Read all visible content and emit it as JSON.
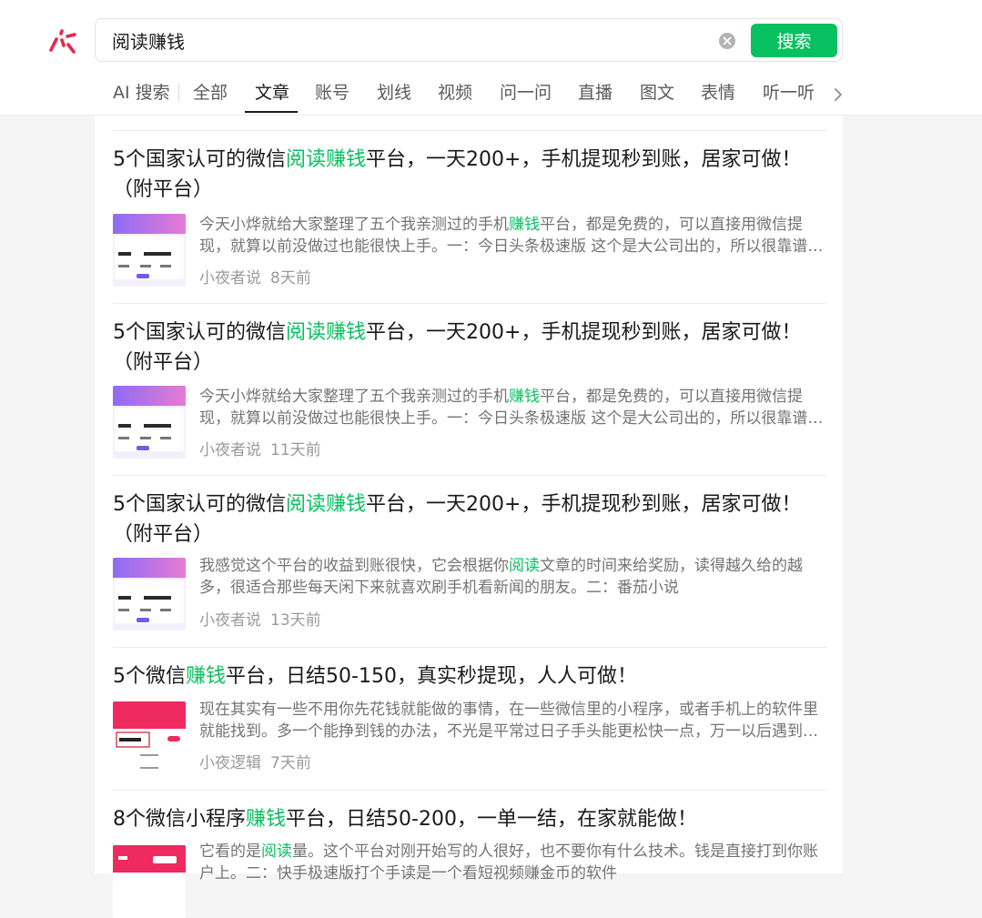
{
  "header": {
    "search": {
      "value": "阅读赚钱",
      "placeholder": "",
      "button_label": "搜索"
    },
    "tabs": [
      {
        "label": "AI 搜索"
      },
      {
        "label": "全部"
      },
      {
        "label": "文章"
      },
      {
        "label": "账号"
      },
      {
        "label": "划线"
      },
      {
        "label": "视频"
      },
      {
        "label": "问一问"
      },
      {
        "label": "直播"
      },
      {
        "label": "图文"
      },
      {
        "label": "表情"
      },
      {
        "label": "听一听"
      }
    ],
    "active_tab": "文章"
  },
  "colors": {
    "accent": "#07c160",
    "logo": "#e8264b"
  },
  "results": [
    {
      "title": [
        {
          "t": "5个国家认可的微信"
        },
        {
          "t": "阅读赚钱",
          "hl": true
        },
        {
          "t": "平台，一天200+，手机提现秒到账，居家可做！（附平台）"
        }
      ],
      "desc": [
        {
          "t": "今天小烨就给大家整理了五个我亲测过的手机"
        },
        {
          "t": "赚钱",
          "hl": true
        },
        {
          "t": "平台，都是免费的，可以直接用微信提现，就算以前没做过也能很快上手。一：今日头条极速版 这个是大公司出的，所以很靠谱，每天签到、看新闻、看视频都能赚金币"
        }
      ],
      "source": "小夜者说",
      "time": "8天前",
      "thumb_icon": "app-balance-screenshot"
    },
    {
      "title": [
        {
          "t": "5个国家认可的微信"
        },
        {
          "t": "阅读赚钱",
          "hl": true
        },
        {
          "t": "平台，一天200+，手机提现秒到账，居家可做！（附平台）"
        }
      ],
      "desc": [
        {
          "t": "今天小烨就给大家整理了五个我亲测过的手机"
        },
        {
          "t": "赚钱",
          "hl": true
        },
        {
          "t": "平台，都是免费的，可以直接用微信提现，就算以前没做过也能很快上手。一：今日头条极速版 这个是大公司出的，所以很靠谱，每天签到、看新闻、看视频都能赚金币"
        }
      ],
      "source": "小夜者说",
      "time": "11天前",
      "thumb_icon": "app-balance-screenshot"
    },
    {
      "title": [
        {
          "t": "5个国家认可的微信"
        },
        {
          "t": "阅读赚钱",
          "hl": true
        },
        {
          "t": "平台，一天200+，手机提现秒到账，居家可做！（附平台）"
        }
      ],
      "desc": [
        {
          "t": "我感觉这个平台的收益到账很快，它会根据你"
        },
        {
          "t": "阅读",
          "hl": true
        },
        {
          "t": "文章的时间来给奖励，读得越久给的越多，很适合那些每天闲下来就喜欢刷手机看新闻的朋友。二：番茄小说"
        }
      ],
      "source": "小夜者说",
      "time": "13天前",
      "thumb_icon": "app-balance-screenshot"
    },
    {
      "title": [
        {
          "t": "5个微信"
        },
        {
          "t": "赚钱",
          "hl": true
        },
        {
          "t": "平台，日结50-150，真实秒提现，人人可做！"
        }
      ],
      "desc": [
        {
          "t": "现在其实有一些不用你先花钱就能做的事情，在一些微信里的小程序，或者手机上的软件里就能找到。多一个能挣到钱的办法，不光是平常过日子手头能更松快一点，万一以后遇到事情也能多一份底气"
        }
      ],
      "source": "小夜逻辑",
      "time": "7天前",
      "thumb_icon": "wallet-screenshot"
    },
    {
      "title": [
        {
          "t": "8个微信小程序"
        },
        {
          "t": "赚钱",
          "hl": true
        },
        {
          "t": "平台，日结50-200，一单一结，在家就能做！"
        }
      ],
      "desc": [
        {
          "t": "它看的是"
        },
        {
          "t": "阅读",
          "hl": true
        },
        {
          "t": "量。这个平台对刚开始写的人很好，也不要你有什么技术。钱是直接打到你账户上。二：快手极速版打个手读是一个看短视频赚金币的软件"
        }
      ],
      "source": "",
      "time": "",
      "thumb_icon": "wallet-screenshot"
    }
  ]
}
